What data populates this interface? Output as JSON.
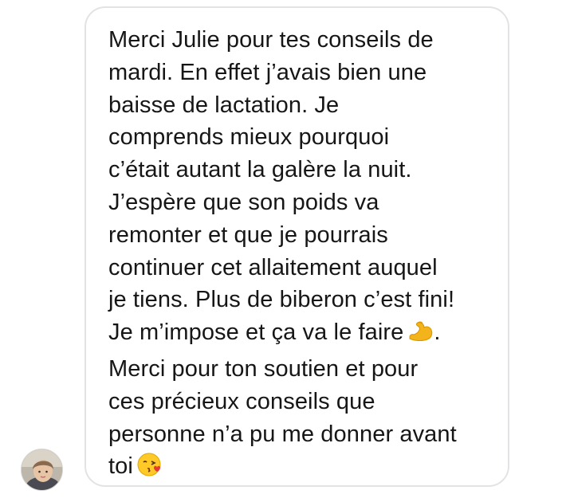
{
  "conversation": {
    "message": {
      "lines": [
        "Merci Julie pour tes conseils de",
        "mardi. En effet j’avais bien une",
        "baisse de lactation. Je",
        "comprends mieux pourquoi",
        "c’était autant la galère la nuit.",
        "J’espère que son poids va",
        "remonter et que je pourrais",
        "continuer cet allaitement auquel",
        "je tiens. Plus de biberon c’est fini!",
        "Je m’impose et ça va le faire",
        ".",
        "Merci pour ton soutien et pour",
        "ces précieux conseils que",
        "personne n’a pu me donner avant",
        "toi"
      ]
    },
    "icons": {
      "flexed_biceps": "flexed-biceps-icon",
      "kiss_face": "face-blowing-kiss-icon",
      "avatar": "avatar-photo"
    },
    "colors": {
      "bubble_border": "#e3e3e6",
      "text": "#161616",
      "background": "#ffffff"
    }
  }
}
